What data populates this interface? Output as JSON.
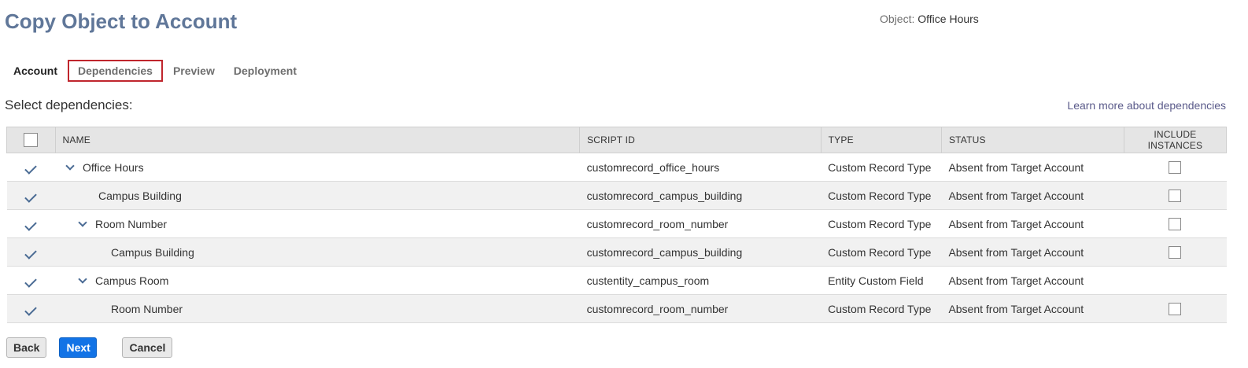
{
  "title": "Copy Object to Account",
  "object": {
    "label": "Object:",
    "value": "Office Hours"
  },
  "tabs": [
    {
      "label": "Account"
    },
    {
      "label": "Dependencies"
    },
    {
      "label": "Preview"
    },
    {
      "label": "Deployment"
    }
  ],
  "subtitle": "Select dependencies:",
  "learn_more": "Learn more about dependencies",
  "table": {
    "headers": {
      "name": "NAME",
      "script_id": "SCRIPT ID",
      "type": "TYPE",
      "status": "STATUS",
      "include_instances": "INCLUDE INSTANCES"
    },
    "rows": [
      {
        "name": "Office Hours",
        "script_id": "customrecord_office_hours",
        "type": "Custom Record Type",
        "status": "Absent from Target Account"
      },
      {
        "name": "Campus Building",
        "script_id": "customrecord_campus_building",
        "type": "Custom Record Type",
        "status": "Absent from Target Account"
      },
      {
        "name": "Room Number",
        "script_id": "customrecord_room_number",
        "type": "Custom Record Type",
        "status": "Absent from Target Account"
      },
      {
        "name": "Campus Building",
        "script_id": "customrecord_campus_building",
        "type": "Custom Record Type",
        "status": "Absent from Target Account"
      },
      {
        "name": "Campus Room",
        "script_id": "custentity_campus_room",
        "type": "Entity Custom Field",
        "status": "Absent from Target Account"
      },
      {
        "name": "Room Number",
        "script_id": "customrecord_room_number",
        "type": "Custom Record Type",
        "status": "Absent from Target Account"
      }
    ]
  },
  "buttons": {
    "back": "Back",
    "next": "Next",
    "cancel": "Cancel"
  },
  "colors": {
    "title": "#607799",
    "primary_button": "#1273e6",
    "focus_border": "#c0262d",
    "check": "#4a6b94"
  }
}
